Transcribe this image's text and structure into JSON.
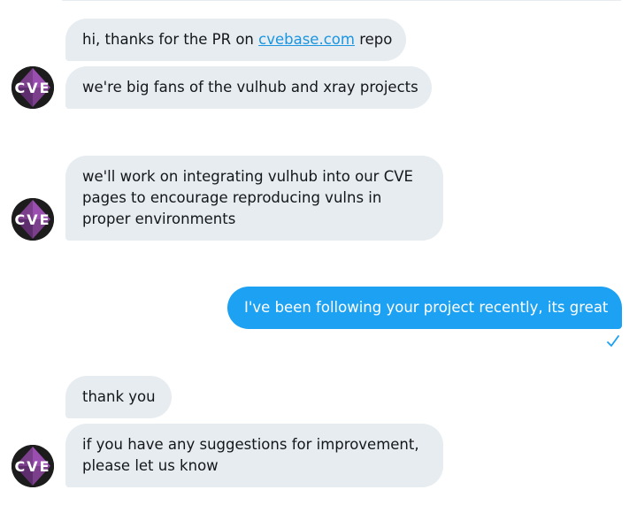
{
  "messages": {
    "m1": {
      "prefix": "hi, thanks for the PR on ",
      "link": "cvebase.com",
      "suffix": " repo"
    },
    "m2": "we're big fans of the vulhub and xray projects",
    "m3": [
      "we'll work on integrating vulhub into our CVE",
      "pages to encourage reproducing vulns in",
      "proper environments"
    ],
    "m4": "I've been following your project recently, its great",
    "m5": "thank you",
    "m6": [
      "if you have any suggestions for improvement,",
      "please let us know"
    ]
  },
  "avatar": {
    "text": "CVE"
  },
  "colors": {
    "incoming_bubble": "#e6ecf0",
    "outgoing_bubble": "#1da1f2",
    "link": "#1b95e0",
    "read_check": "#1da1f2"
  }
}
